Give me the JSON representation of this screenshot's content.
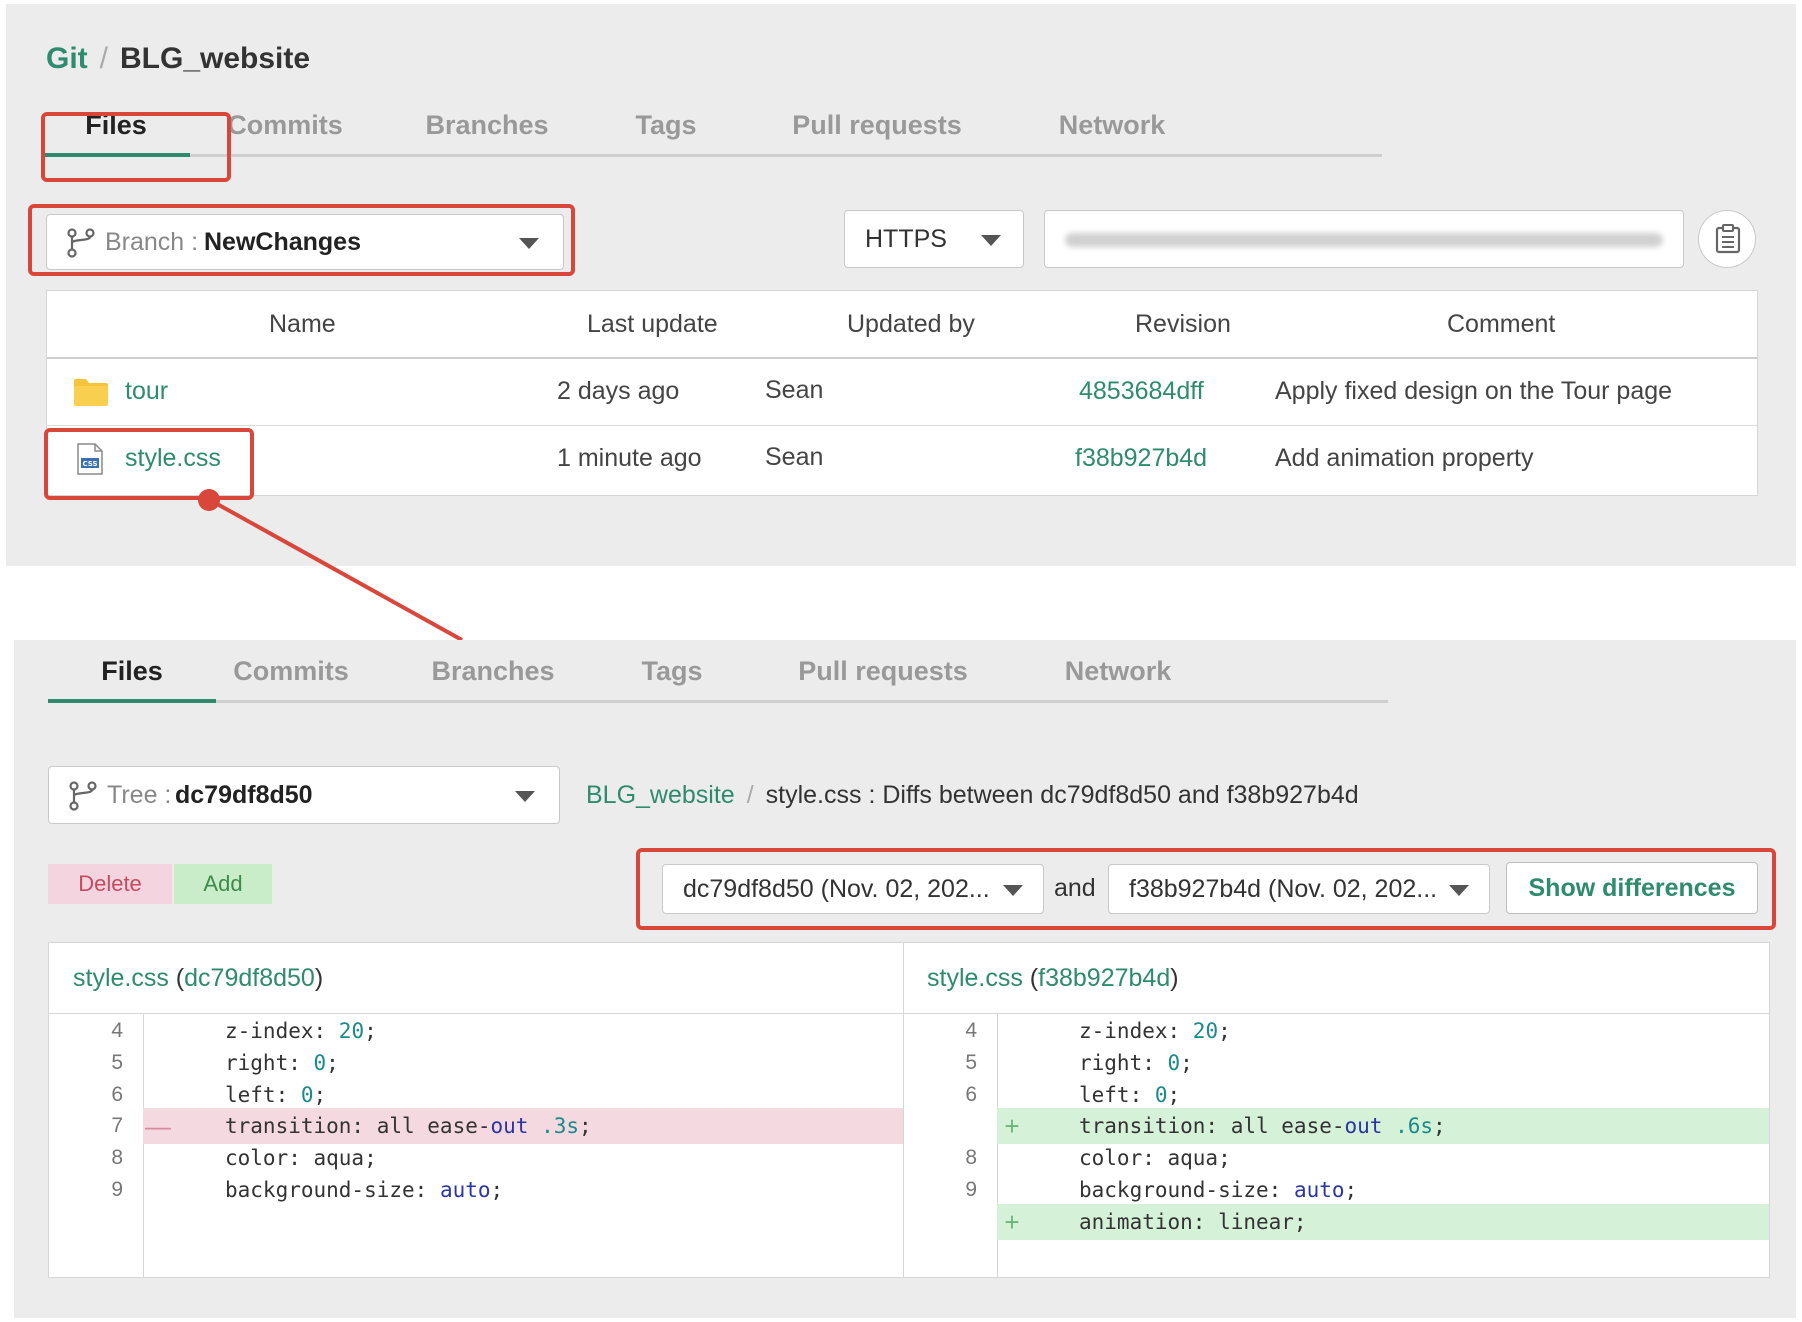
{
  "top": {
    "breadcrumb": {
      "root": "Git",
      "separator": "/",
      "repo": "BLG_website"
    },
    "tabs": [
      "Files",
      "Commits",
      "Branches",
      "Tags",
      "Pull requests",
      "Network"
    ],
    "branch": {
      "prefix": "Branch : ",
      "value": "NewChanges"
    },
    "protocol": "HTTPS",
    "table": {
      "headers": [
        "Name",
        "Last update",
        "Updated by",
        "Revision",
        "Comment"
      ],
      "rows": [
        {
          "icon": "folder-icon",
          "name": "tour",
          "last_update": "2 days ago",
          "updated_by": "Sean",
          "revision": "4853684dff",
          "comment": "Apply fixed design on the Tour page"
        },
        {
          "icon": "css-file-icon",
          "name": "style.css",
          "last_update": "1 minute ago",
          "updated_by": "Sean",
          "revision": "f38b927b4d",
          "comment": "Add animation property"
        }
      ]
    }
  },
  "bottom": {
    "tabs": [
      "Files",
      "Commits",
      "Branches",
      "Tags",
      "Pull requests",
      "Network"
    ],
    "tree": {
      "prefix": "Tree : ",
      "value": "dc79df8d50"
    },
    "path": {
      "repo": "BLG_website",
      "separator": "/",
      "title": "style.css : Diffs between dc79df8d50 and f38b927b4d"
    },
    "legend": {
      "delete": "Delete",
      "add": "Add"
    },
    "compare": {
      "from": "dc79df8d50 (Nov. 02, 202...",
      "and": "and",
      "to": "f38b927b4d (Nov. 02, 202...",
      "button": "Show differences"
    },
    "left": {
      "file": "style.css",
      "rev": "dc79df8d50",
      "lines": [
        {
          "n": "4",
          "text": "z-index: 20;",
          "type": "ctx"
        },
        {
          "n": "5",
          "text": "right: 0;",
          "type": "ctx"
        },
        {
          "n": "6",
          "text": "left: 0;",
          "type": "ctx"
        },
        {
          "n": "7",
          "text": "transition: all ease-out .3s;",
          "type": "del"
        },
        {
          "n": "8",
          "text": "color: aqua;",
          "type": "ctx"
        },
        {
          "n": "9",
          "text": "background-size: auto;",
          "type": "ctx"
        }
      ]
    },
    "right": {
      "file": "style.css",
      "rev": "f38b927b4d",
      "lines": [
        {
          "n": "4",
          "text": "z-index: 20;",
          "type": "ctx"
        },
        {
          "n": "5",
          "text": "right: 0;",
          "type": "ctx"
        },
        {
          "n": "6",
          "text": "left: 0;",
          "type": "ctx"
        },
        {
          "n": "",
          "text": "transition: all ease-out .6s;",
          "type": "add"
        },
        {
          "n": "8",
          "text": "color: aqua;",
          "type": "ctx"
        },
        {
          "n": "9",
          "text": "background-size: auto;",
          "type": "ctx"
        },
        {
          "n": "",
          "text": "animation: linear;",
          "type": "add"
        }
      ]
    }
  },
  "colors": {
    "accent": "#2e8b6e",
    "highlight": "#d9463a",
    "deleted": "#f5d9e1",
    "added": "#d5f2d8"
  }
}
